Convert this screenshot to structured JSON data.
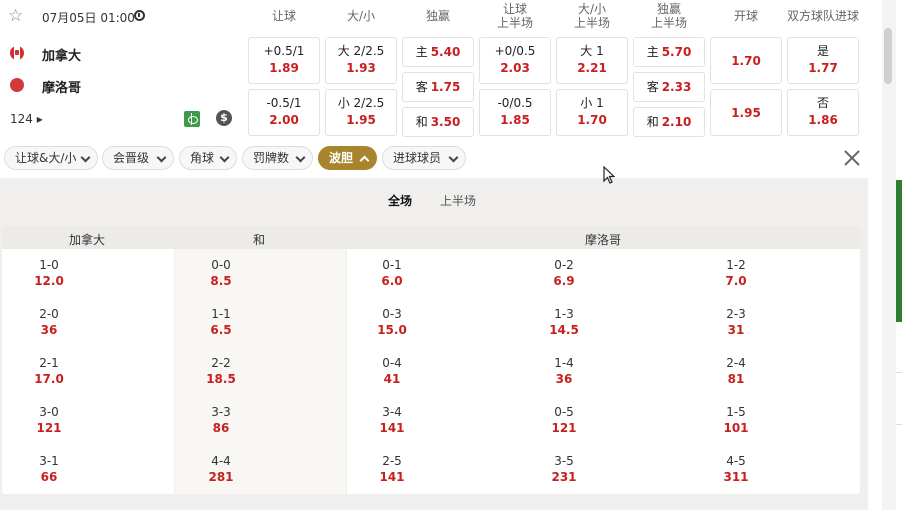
{
  "match": {
    "datetime": "07月05日 01:00",
    "home": "加拿大",
    "away": "摩洛哥",
    "more_markets": "124 ▸",
    "dollar_symbol": "$"
  },
  "columns": [
    {
      "l1": "让球",
      "l2": ""
    },
    {
      "l1": "大/小",
      "l2": ""
    },
    {
      "l1": "独赢",
      "l2": ""
    },
    {
      "l1": "让球",
      "l2": "上半场"
    },
    {
      "l1": "大/小",
      "l2": "上半场"
    },
    {
      "l1": "独赢",
      "l2": "上半场"
    },
    {
      "l1": "开球",
      "l2": ""
    },
    {
      "l1": "双方球队进球",
      "l2": ""
    }
  ],
  "odds": {
    "handicap": [
      {
        "line": "+0.5/1",
        "val": "1.89"
      },
      {
        "line": "-0.5/1",
        "val": "2.00"
      }
    ],
    "overunder": [
      {
        "line": "大 2/2.5",
        "val": "1.93"
      },
      {
        "line": "小 2/2.5",
        "val": "1.95"
      }
    ],
    "moneyline": [
      {
        "line": "主",
        "val": "5.40"
      },
      {
        "line": "客",
        "val": "1.75"
      },
      {
        "line": "和",
        "val": "3.50"
      }
    ],
    "handicap_1h": [
      {
        "line": "+0/0.5",
        "val": "2.03"
      },
      {
        "line": "-0/0.5",
        "val": "1.85"
      }
    ],
    "overunder_1h": [
      {
        "line": "大 1",
        "val": "2.21"
      },
      {
        "line": "小 1",
        "val": "1.70"
      }
    ],
    "moneyline_1h": [
      {
        "line": "主",
        "val": "5.70"
      },
      {
        "line": "客",
        "val": "2.33"
      },
      {
        "line": "和",
        "val": "2.10"
      }
    ],
    "kickoff": [
      {
        "val": "1.70"
      },
      {
        "val": "1.95"
      }
    ],
    "btts": [
      {
        "line": "是",
        "val": "1.77"
      },
      {
        "line": "否",
        "val": "1.86"
      }
    ]
  },
  "filters": [
    "让球&大/小",
    "会晋级",
    "角球",
    "罚牌数",
    "波胆",
    "进球球员"
  ],
  "active_filter": "波胆",
  "tabs": [
    "全场",
    "上半场"
  ],
  "active_tab": "全场",
  "score_headers": {
    "home": "加拿大",
    "draw": "和",
    "away": "摩洛哥"
  },
  "score_columns": [
    [
      {
        "s": "1-0",
        "o": "12.0"
      },
      {
        "s": "2-0",
        "o": "36"
      },
      {
        "s": "2-1",
        "o": "17.0"
      },
      {
        "s": "3-0",
        "o": "121"
      },
      {
        "s": "3-1",
        "o": "66"
      }
    ],
    [
      {
        "s": "0-0",
        "o": "8.5"
      },
      {
        "s": "1-1",
        "o": "6.5"
      },
      {
        "s": "2-2",
        "o": "18.5"
      },
      {
        "s": "3-3",
        "o": "86"
      },
      {
        "s": "4-4",
        "o": "281"
      }
    ],
    [
      {
        "s": "0-1",
        "o": "6.0"
      },
      {
        "s": "0-3",
        "o": "15.0"
      },
      {
        "s": "0-4",
        "o": "41"
      },
      {
        "s": "3-4",
        "o": "141"
      },
      {
        "s": "2-5",
        "o": "141"
      }
    ],
    [
      {
        "s": "0-2",
        "o": "6.9"
      },
      {
        "s": "1-3",
        "o": "14.5"
      },
      {
        "s": "1-4",
        "o": "36"
      },
      {
        "s": "0-5",
        "o": "121"
      },
      {
        "s": "3-5",
        "o": "231"
      }
    ],
    [
      {
        "s": "1-2",
        "o": "7.0"
      },
      {
        "s": "2-3",
        "o": "31"
      },
      {
        "s": "2-4",
        "o": "81"
      },
      {
        "s": "1-5",
        "o": "101"
      },
      {
        "s": "4-5",
        "o": "311"
      }
    ]
  ]
}
